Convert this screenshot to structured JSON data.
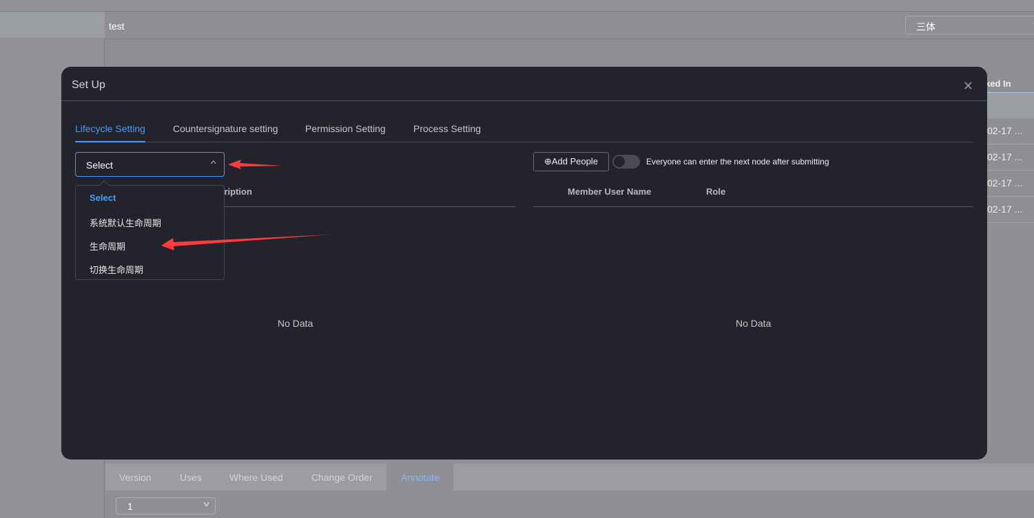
{
  "header": {
    "title": "test",
    "search_value": "三体"
  },
  "background_table": {
    "column_partial": "ked In",
    "rows": [
      "02-17 ...",
      "02-17 ...",
      "02-17 ...",
      "02-17 ..."
    ]
  },
  "modal": {
    "title": "Set Up",
    "tabs": [
      {
        "label": "Lifecycle Setting",
        "active": true
      },
      {
        "label": "Countersignature setting"
      },
      {
        "label": "Permission Setting"
      },
      {
        "label": "Process Setting"
      }
    ],
    "lifecycle_select": {
      "value": "Select",
      "options": [
        "Select",
        "系统默认生命周期",
        "生命周期",
        "切换生命周期"
      ],
      "selected": "Select"
    },
    "left_table": {
      "header_partial": "scription",
      "empty": "No Data"
    },
    "add_people_label": "⊕Add People",
    "toggle": {
      "label": "Everyone can enter the next node after submitting",
      "on": false
    },
    "right_table": {
      "headers": [
        "Member User Name",
        "Role"
      ],
      "empty": "No Data"
    }
  },
  "bottom_tabs": [
    {
      "label": "Version"
    },
    {
      "label": "Uses"
    },
    {
      "label": "Where Used"
    },
    {
      "label": "Change Order"
    },
    {
      "label": "Annotate",
      "active": true
    }
  ],
  "version_select": {
    "value": "1"
  },
  "colors": {
    "accent": "#409eff",
    "annotation_arrow": "#ff3b3b",
    "modal_bg": "#22232c"
  }
}
